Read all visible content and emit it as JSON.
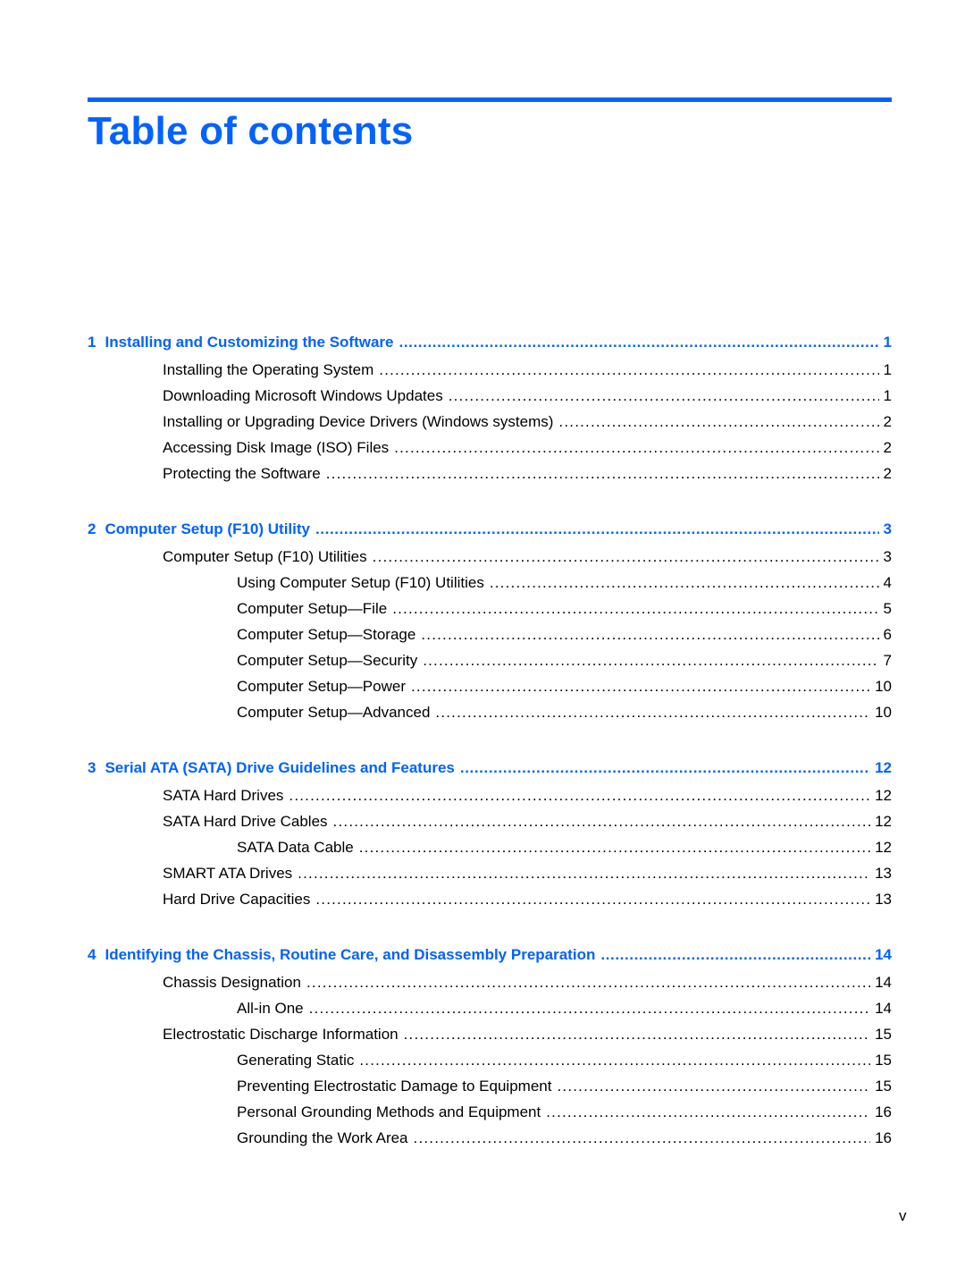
{
  "page": {
    "title": "Table of contents",
    "folio": "v",
    "accent_color": "#0062ff"
  },
  "toc": [
    {
      "number": "1",
      "title": "Installing and Customizing the Software",
      "page": "1",
      "entries": [
        {
          "level": 1,
          "title": "Installing the Operating System",
          "page": "1"
        },
        {
          "level": 1,
          "title": "Downloading Microsoft Windows Updates",
          "page": "1"
        },
        {
          "level": 1,
          "title": "Installing or Upgrading Device Drivers (Windows systems)",
          "page": "2"
        },
        {
          "level": 1,
          "title": "Accessing Disk Image (ISO) Files",
          "page": "2"
        },
        {
          "level": 1,
          "title": "Protecting the Software",
          "page": "2"
        }
      ]
    },
    {
      "number": "2",
      "title": "Computer Setup (F10) Utility",
      "page": "3",
      "entries": [
        {
          "level": 1,
          "title": "Computer Setup (F10) Utilities",
          "page": "3"
        },
        {
          "level": 2,
          "title": "Using Computer Setup (F10) Utilities",
          "page": "4"
        },
        {
          "level": 2,
          "title": "Computer Setup—File",
          "page": "5"
        },
        {
          "level": 2,
          "title": "Computer Setup—Storage",
          "page": "6"
        },
        {
          "level": 2,
          "title": "Computer Setup—Security",
          "page": "7"
        },
        {
          "level": 2,
          "title": "Computer Setup—Power",
          "page": "10"
        },
        {
          "level": 2,
          "title": "Computer Setup—Advanced",
          "page": "10"
        }
      ]
    },
    {
      "number": "3",
      "title": "Serial ATA (SATA) Drive Guidelines and Features",
      "page": "12",
      "entries": [
        {
          "level": 1,
          "title": "SATA Hard Drives",
          "page": "12"
        },
        {
          "level": 1,
          "title": "SATA Hard Drive Cables",
          "page": "12"
        },
        {
          "level": 2,
          "title": "SATA Data Cable",
          "page": "12"
        },
        {
          "level": 1,
          "title": "SMART ATA Drives",
          "page": "13"
        },
        {
          "level": 1,
          "title": "Hard Drive Capacities",
          "page": "13"
        }
      ]
    },
    {
      "number": "4",
      "title": "Identifying the Chassis, Routine Care, and Disassembly Preparation",
      "page": "14",
      "entries": [
        {
          "level": 1,
          "title": "Chassis Designation",
          "page": "14"
        },
        {
          "level": 2,
          "title": "All-in One",
          "page": "14"
        },
        {
          "level": 1,
          "title": "Electrostatic Discharge Information",
          "page": "15"
        },
        {
          "level": 2,
          "title": "Generating Static",
          "page": "15"
        },
        {
          "level": 2,
          "title": "Preventing Electrostatic Damage to Equipment",
          "page": "15"
        },
        {
          "level": 2,
          "title": "Personal Grounding Methods and Equipment",
          "page": "16"
        },
        {
          "level": 2,
          "title": "Grounding the Work Area",
          "page": "16"
        }
      ]
    }
  ]
}
